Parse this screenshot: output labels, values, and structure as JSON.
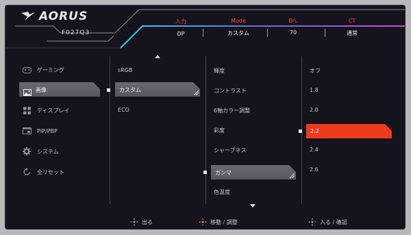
{
  "brand": {
    "logo_text": "AORUS",
    "model": "F027Q3"
  },
  "status": [
    {
      "label": "入力",
      "value": "DP"
    },
    {
      "label": "Mode",
      "value": "カスタム"
    },
    {
      "label": "Bri.",
      "value": "70"
    },
    {
      "label": "CT",
      "value": "通常"
    }
  ],
  "menu": [
    {
      "label": "ゲーミング",
      "icon": "gamepad-icon"
    },
    {
      "label": "画像",
      "icon": "picture-icon",
      "selected": true
    },
    {
      "label": "ディスプレイ",
      "icon": "display-grid-icon"
    },
    {
      "label": "PIP/PBP",
      "icon": "pip-icon"
    },
    {
      "label": "システム",
      "icon": "gear-icon"
    },
    {
      "label": "全リセット",
      "icon": "reset-icon"
    }
  ],
  "modes": [
    "sRGB",
    "カスタム",
    "ECO"
  ],
  "modes_selected": "カスタム",
  "settings": [
    "輝度",
    "コントラスト",
    "6軸カラー調整",
    "彩度",
    "シャープネス",
    "ガンマ",
    "色温度"
  ],
  "settings_selected": "ガンマ",
  "values": [
    "オフ",
    "1.8",
    "2.0",
    "2.2",
    "2.4",
    "2.6"
  ],
  "values_selected": "2.2",
  "footer": [
    {
      "label": "出る",
      "icon": "joystick-icon"
    },
    {
      "label": "移動 / 調整",
      "icon": "joystick-icon"
    },
    {
      "label": "入る / 確認",
      "icon": "joystick-icon"
    }
  ],
  "colors": {
    "accent": "#ee3a1f",
    "label_red": "#ff4a3a",
    "background": "#15131c"
  }
}
